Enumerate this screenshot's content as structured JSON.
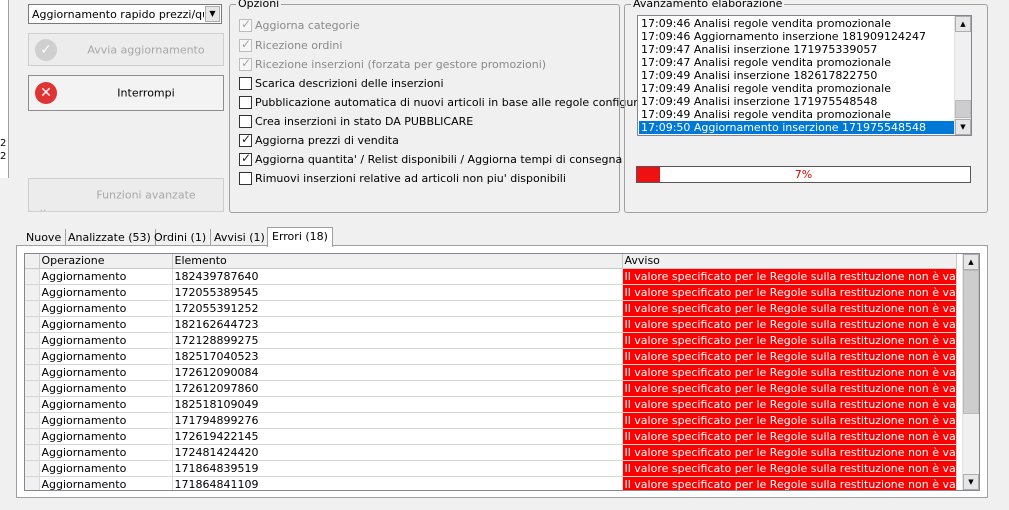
{
  "left_strip": {
    "chars": [
      "2",
      "2"
    ]
  },
  "mode_select": {
    "value": "Aggiornamento rapido prezzi/quantità"
  },
  "buttons": {
    "start": "Avvia aggiornamento",
    "stop": "Interrompi",
    "advanced": "Funzioni avanzate"
  },
  "options": {
    "title": "Opzioni",
    "items": [
      {
        "label": "Aggiorna categorie",
        "checked": true,
        "enabled": false
      },
      {
        "label": "Ricezione ordini",
        "checked": true,
        "enabled": false
      },
      {
        "label": "Ricezione inserzioni (forzata per gestore promozioni)",
        "checked": true,
        "enabled": false
      },
      {
        "label": "Scarica descrizioni delle inserzioni",
        "checked": false,
        "enabled": true
      },
      {
        "label": "Pubblicazione automatica di nuovi articoli in base alle regole configurate",
        "checked": false,
        "enabled": true
      },
      {
        "label": "Crea inserzioni in stato DA PUBBLICARE",
        "checked": false,
        "enabled": true
      },
      {
        "label": "Aggiorna prezzi di vendita",
        "checked": true,
        "enabled": true
      },
      {
        "label": "Aggiorna quantita' / Relist disponibili / Aggiorna tempi di consegna",
        "checked": true,
        "enabled": true
      },
      {
        "label": "Rimuovi inserzioni relative ad articoli non piu' disponibili",
        "checked": false,
        "enabled": true
      }
    ]
  },
  "progress": {
    "title": "Avanzamento elaborazione",
    "log": [
      "17:09:46 Analisi regole vendita promozionale",
      "17:09:46 Aggiornamento inserzione 181909124247",
      "17:09:47 Analisi inserzione 171975339057",
      "17:09:47 Analisi regole vendita promozionale",
      "17:09:49 Analisi inserzione 182617822750",
      "17:09:49 Analisi regole vendita promozionale",
      "17:09:49 Analisi inserzione 171975548548",
      "17:09:49 Analisi regole vendita promozionale",
      "17:09:50 Aggiornamento inserzione 171975548548"
    ],
    "selected_index": 8,
    "percent_label": "7%",
    "percent_value": 0.07,
    "bar_color": "#ee1111"
  },
  "tabs": [
    {
      "label": "Nuove",
      "active": false
    },
    {
      "label": "Analizzate (53)",
      "active": false
    },
    {
      "label": "Ordini (1)",
      "active": false
    },
    {
      "label": "Avvisi (1)",
      "active": false
    },
    {
      "label": "Errori (18)",
      "active": true
    }
  ],
  "grid": {
    "columns": [
      "Operazione",
      "Elemento",
      "Avviso"
    ],
    "warn_color": "#ff0000",
    "rows": [
      [
        "Aggiornamento",
        "182439787640",
        "Il valore specificato per le Regole sulla restituzione non è valido. -..."
      ],
      [
        "Aggiornamento",
        "172055389545",
        "Il valore specificato per le Regole sulla restituzione non è valido. -..."
      ],
      [
        "Aggiornamento",
        "172055391252",
        "Il valore specificato per le Regole sulla restituzione non è valido. -..."
      ],
      [
        "Aggiornamento",
        "182162644723",
        "Il valore specificato per le Regole sulla restituzione non è valido. -..."
      ],
      [
        "Aggiornamento",
        "172128899275",
        "Il valore specificato per le Regole sulla restituzione non è valido. -..."
      ],
      [
        "Aggiornamento",
        "182517040523",
        "Il valore specificato per le Regole sulla restituzione non è valido. -..."
      ],
      [
        "Aggiornamento",
        "172612090084",
        "Il valore specificato per le Regole sulla restituzione non è valido. -..."
      ],
      [
        "Aggiornamento",
        "172612097860",
        "Il valore specificato per le Regole sulla restituzione non è valido. -..."
      ],
      [
        "Aggiornamento",
        "182518109049",
        "Il valore specificato per le Regole sulla restituzione non è valido. -..."
      ],
      [
        "Aggiornamento",
        "171794899276",
        "Il valore specificato per le Regole sulla restituzione non è valido. -..."
      ],
      [
        "Aggiornamento",
        "172619422145",
        "Il valore specificato per le Regole sulla restituzione non è valido. -..."
      ],
      [
        "Aggiornamento",
        "172481424420",
        "Il valore specificato per le Regole sulla restituzione non è valido. -..."
      ],
      [
        "Aggiornamento",
        "171864839519",
        "Il valore specificato per le Regole sulla restituzione non è valido. -..."
      ],
      [
        "Aggiornamento",
        "171864841109",
        "Il valore specificato per le Regole sulla restituzione non è valido. -..."
      ]
    ]
  }
}
